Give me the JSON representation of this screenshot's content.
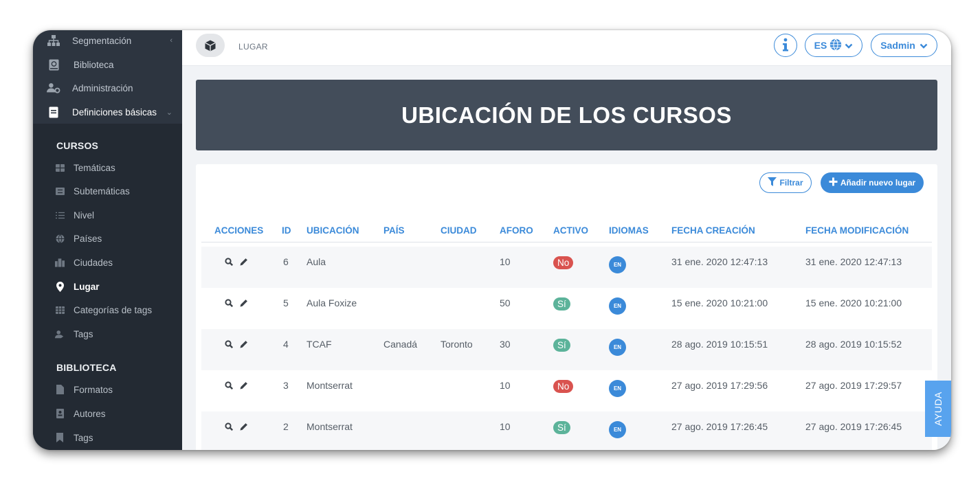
{
  "sidebar": {
    "items": [
      {
        "label": "Segmentación",
        "icon": "sitemap-icon"
      },
      {
        "label": "Biblioteca",
        "icon": "book-icon"
      },
      {
        "label": "Administración",
        "icon": "user-gear-icon"
      },
      {
        "label": "Definiciones básicas",
        "icon": "book-open-icon"
      }
    ],
    "sections": [
      {
        "title": "CURSOS",
        "items": [
          {
            "label": "Temáticas"
          },
          {
            "label": "Subtemáticas"
          },
          {
            "label": "Nivel"
          },
          {
            "label": "Países"
          },
          {
            "label": "Ciudades"
          },
          {
            "label": "Lugar"
          },
          {
            "label": "Categorías de tags"
          },
          {
            "label": "Tags"
          }
        ]
      },
      {
        "title": "BIBLIOTECA",
        "items": [
          {
            "label": "Formatos"
          },
          {
            "label": "Autores"
          },
          {
            "label": "Tags"
          }
        ]
      }
    ]
  },
  "topbar": {
    "breadcrumb": "LUGAR",
    "language": "ES",
    "user": "Sadmin"
  },
  "banner": {
    "title": "UBICACIÓN DE LOS CURSOS"
  },
  "toolbar": {
    "filter_label": "Filtrar",
    "add_label": "Añadir nuevo lugar"
  },
  "table": {
    "headers": [
      "ACCIONES",
      "ID",
      "UBICACIÓN",
      "PAÍS",
      "CIUDAD",
      "AFORO",
      "ACTIVO",
      "IDIOMAS",
      "FECHA CREACIÓN",
      "FECHA MODIFICACIÓN"
    ],
    "rows": [
      {
        "id": "6",
        "ubicacion": "Aula",
        "pais": "",
        "ciudad": "",
        "aforo": "10",
        "activo": "No",
        "idioma": "EN",
        "creacion": "31 ene. 2020 12:47:13",
        "modificacion": "31 ene. 2020 12:47:13"
      },
      {
        "id": "5",
        "ubicacion": "Aula Foxize",
        "pais": "",
        "ciudad": "",
        "aforo": "50",
        "activo": "Sí",
        "idioma": "EN",
        "creacion": "15 ene. 2020 10:21:00",
        "modificacion": "15 ene. 2020 10:21:00"
      },
      {
        "id": "4",
        "ubicacion": "TCAF",
        "pais": "Canadá",
        "ciudad": "Toronto",
        "aforo": "30",
        "activo": "Sí",
        "idioma": "EN",
        "creacion": "28 ago. 2019 10:15:51",
        "modificacion": "28 ago. 2019 10:15:52"
      },
      {
        "id": "3",
        "ubicacion": "Montserrat",
        "pais": "",
        "ciudad": "",
        "aforo": "10",
        "activo": "No",
        "idioma": "EN",
        "creacion": "27 ago. 2019 17:29:56",
        "modificacion": "27 ago. 2019 17:29:57"
      },
      {
        "id": "2",
        "ubicacion": "Montserrat",
        "pais": "",
        "ciudad": "",
        "aforo": "10",
        "activo": "Sí",
        "idioma": "EN",
        "creacion": "27 ago. 2019 17:26:45",
        "modificacion": "27 ago. 2019 17:26:45"
      }
    ]
  },
  "help": {
    "label": "AYUDA"
  },
  "colors": {
    "accent": "#3b8ad9",
    "sidebar": "#2d3540",
    "banner": "#434d5a",
    "badge_no": "#d9534f",
    "badge_si": "#5cb39a"
  }
}
